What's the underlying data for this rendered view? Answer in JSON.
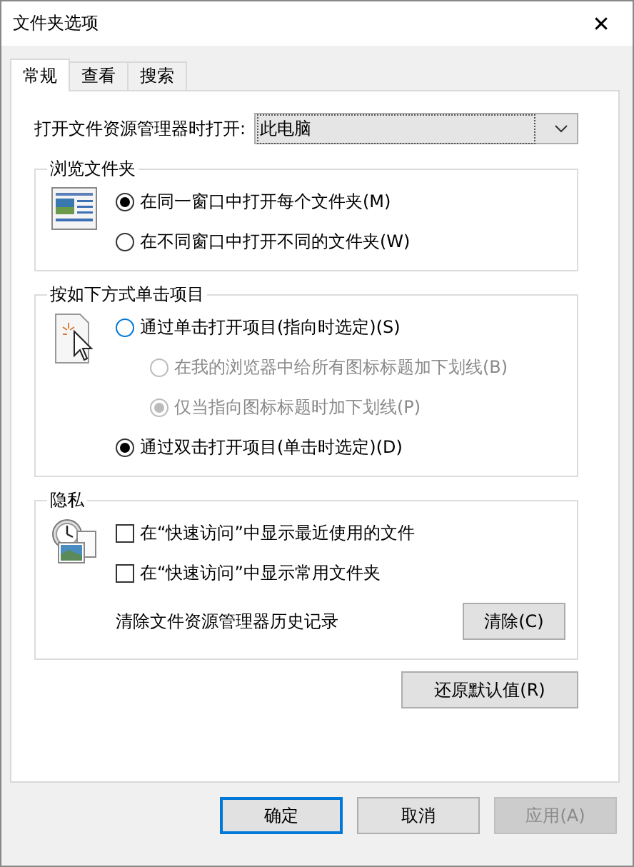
{
  "window": {
    "title": "文件夹选项",
    "close": "✕"
  },
  "tabs": [
    {
      "label": "常规",
      "selected": true
    },
    {
      "label": "查看",
      "selected": false
    },
    {
      "label": "搜索",
      "selected": false
    }
  ],
  "open_in": {
    "label": "打开文件资源管理器时打开:",
    "value": "此电脑"
  },
  "groups": [
    {
      "title": "浏览文件夹",
      "kind": "window",
      "items": [
        {
          "kind": "radio",
          "label": "在同一窗口中打开每个文件夹(M)",
          "selected": true,
          "disabled": false
        },
        {
          "kind": "radio",
          "label": "在不同窗口中打开不同的文件夹(W)",
          "selected": false,
          "disabled": false
        }
      ]
    },
    {
      "title": "按如下方式单击项目",
      "kind": "pointer",
      "items": [
        {
          "kind": "radio",
          "label": "通过单击打开项目(指向时选定)(S)",
          "selected": false,
          "disabled": false,
          "focused": true,
          "children": [
            {
              "kind": "radio",
              "label": "在我的浏览器中给所有图标标题加下划线(B)",
              "selected": false,
              "disabled": true
            },
            {
              "kind": "radio",
              "label": "仅当指向图标标题时加下划线(P)",
              "selected": true,
              "disabled": true
            }
          ]
        },
        {
          "kind": "radio",
          "label": "通过双击打开项目(单击时选定)(D)",
          "selected": true,
          "disabled": false
        }
      ]
    },
    {
      "title": "隐私",
      "kind": "clock",
      "items": [
        {
          "kind": "checkbox",
          "label": "在“快速访问”中显示最近使用的文件",
          "checked": false
        },
        {
          "kind": "checkbox",
          "label": "在“快速访问”中显示常用文件夹",
          "checked": false
        },
        {
          "kind": "action",
          "label": "清除文件资源管理器历史记录",
          "button": "清除(C)"
        }
      ]
    }
  ],
  "restore_button": "还原默认值(R)",
  "buttons": [
    {
      "label": "确定",
      "default": true,
      "disabled": false
    },
    {
      "label": "取消",
      "default": false,
      "disabled": false
    },
    {
      "label": "应用(A)",
      "default": false,
      "disabled": true
    }
  ]
}
